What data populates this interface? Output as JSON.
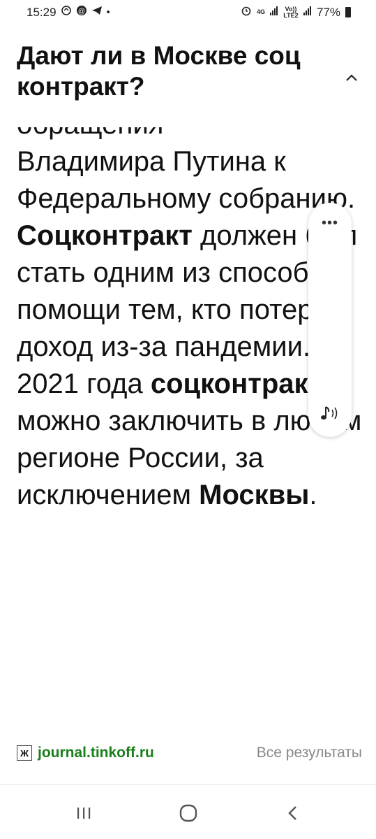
{
  "status_bar": {
    "time": "15:29",
    "network_4g": "4G",
    "volte": "Vo)) LTE2",
    "battery": "77%"
  },
  "header": {
    "title": "Дают ли в Москве соц контракт?"
  },
  "content": {
    "partial_line": "обращения",
    "segments": [
      {
        "text": "Владимира Путина к Федеральному собранию. ",
        "bold": false
      },
      {
        "text": "Соцконтракт",
        "bold": true
      },
      {
        "text": " должен был стать одним из способов помощи тем, кто потерял доход из-за пандемии. С 2021 года ",
        "bold": false
      },
      {
        "text": "соцконтракт",
        "bold": true
      },
      {
        "text": " можно заключить в любом регионе России, за исключением ",
        "bold": false
      },
      {
        "text": "Москвы",
        "bold": true
      },
      {
        "text": ".",
        "bold": false
      }
    ]
  },
  "source": {
    "favicon": "Ж",
    "link": "journal.tinkoff.ru",
    "all_results": "Все результаты"
  },
  "colors": {
    "link": "#1a7f1a",
    "muted": "#888888",
    "text": "#111111"
  }
}
